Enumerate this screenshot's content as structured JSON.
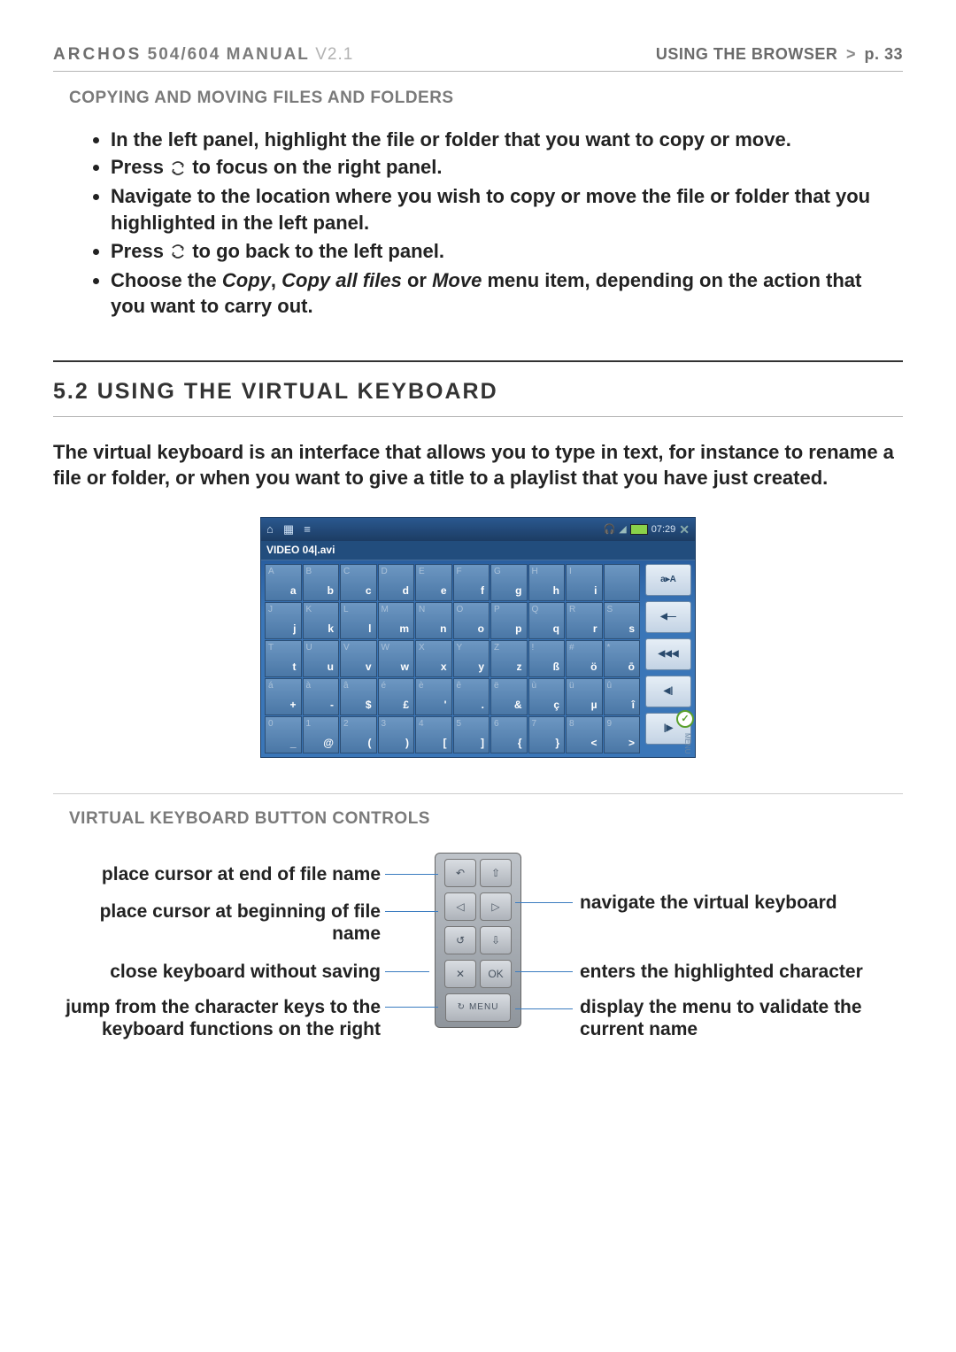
{
  "header": {
    "brand": "ARCHOS",
    "models": "504/604",
    "manual": "MANUAL",
    "version": "V2.1",
    "section": "USING THE BROWSER",
    "page": "p. 33"
  },
  "sect_copy_title": "COPYING AND MOVING FILES AND FOLDERS",
  "bullets": {
    "b1": "In the left panel, highlight the file or folder that you want to copy or move.",
    "b2a": "Press ",
    "b2b": " to focus on the right panel.",
    "b3": "Navigate to the location where you wish to copy or move the file or folder that you highlighted in the left panel.",
    "b4a": "Press ",
    "b4b": " to go back to the left panel.",
    "b5a": "Choose the ",
    "b5_copy": "Copy",
    "b5_sep1": ", ",
    "b5_copyall": "Copy all files",
    "b5_sep2": " or ",
    "b5_move": "Move",
    "b5b": " menu item, depending on the action that you want to carry out."
  },
  "sect52": "5.2  USING THE VIRTUAL KEYBOARD",
  "para52": "The virtual keyboard is an interface that allows you to type in text, for instance to rename a file or folder, or when you want to give a title to a playlist that you have just created.",
  "vk": {
    "clock": "07:29",
    "filename": "VIDEO 04|.avi",
    "side": {
      "s1": "a▸A",
      "s2": "◀—",
      "s3": "◀◀◀",
      "s4": "◀|",
      "s5": "|▶"
    },
    "menu_tag": "MENU",
    "rows": [
      [
        [
          "A",
          "a"
        ],
        [
          "B",
          "b"
        ],
        [
          "C",
          "c"
        ],
        [
          "D",
          "d"
        ],
        [
          "E",
          "e"
        ],
        [
          "F",
          "f"
        ],
        [
          "G",
          "g"
        ],
        [
          "H",
          "h"
        ],
        [
          "I",
          "i"
        ],
        [
          "",
          ""
        ]
      ],
      [
        [
          "J",
          "j"
        ],
        [
          "K",
          "k"
        ],
        [
          "L",
          "l"
        ],
        [
          "M",
          "m"
        ],
        [
          "N",
          "n"
        ],
        [
          "O",
          "o"
        ],
        [
          "P",
          "p"
        ],
        [
          "Q",
          "q"
        ],
        [
          "R",
          "r"
        ],
        [
          "S",
          "s"
        ]
      ],
      [
        [
          "T",
          "t"
        ],
        [
          "U",
          "u"
        ],
        [
          "V",
          "v"
        ],
        [
          "W",
          "w"
        ],
        [
          "X",
          "x"
        ],
        [
          "Y",
          "y"
        ],
        [
          "Z",
          "z"
        ],
        [
          "!",
          "ß"
        ],
        [
          "#",
          "ö"
        ],
        [
          "*",
          "ō"
        ]
      ],
      [
        [
          "á",
          "+"
        ],
        [
          "à",
          "-"
        ],
        [
          "â",
          "$"
        ],
        [
          "é",
          "£"
        ],
        [
          "è",
          "'"
        ],
        [
          "ê",
          "."
        ],
        [
          "ë",
          "&"
        ],
        [
          "ù",
          "ç"
        ],
        [
          "ü",
          "µ"
        ],
        [
          "û",
          "î"
        ]
      ],
      [
        [
          "0",
          "_"
        ],
        [
          "1",
          "@"
        ],
        [
          "2",
          "("
        ],
        [
          "3",
          ")"
        ],
        [
          "4",
          "["
        ],
        [
          "5",
          "]"
        ],
        [
          "6",
          "{"
        ],
        [
          "7",
          "}"
        ],
        [
          "8",
          "<"
        ],
        [
          "9",
          ">"
        ]
      ]
    ]
  },
  "sect_controls_title": "VIRTUAL KEYBOARD BUTTON CONTROLS",
  "labels": {
    "l1": "place cursor at end of file name",
    "l2": "place cursor at beginning of file name",
    "l3": "close keyboard without saving",
    "l4": "jump from the character keys to the keyboard functions on the right",
    "r1": "navigate the virtual keyboard",
    "r2": "enters the highlighted character",
    "r3": "display the menu to validate the current name"
  },
  "remote": {
    "ok": "OK",
    "menu": "MENU"
  }
}
